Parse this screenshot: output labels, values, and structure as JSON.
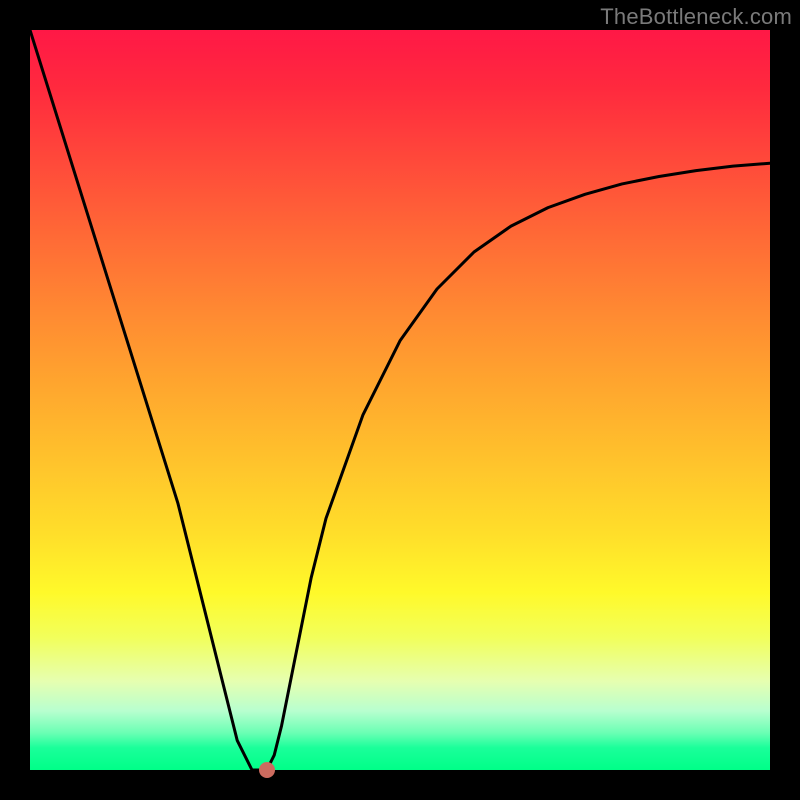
{
  "watermark": "TheBottleneck.com",
  "colors": {
    "frame": "#000000",
    "gradient_top": "#ff1846",
    "gradient_bottom": "#00ff88",
    "curve": "#000000",
    "dot": "#cc6b5f",
    "watermark": "#7a7a7a"
  },
  "chart_data": {
    "type": "line",
    "title": "",
    "xlabel": "",
    "ylabel": "",
    "xlim": [
      0,
      100
    ],
    "ylim": [
      0,
      100
    ],
    "grid": false,
    "legend": false,
    "series": [
      {
        "name": "bottleneck-curve",
        "x": [
          0,
          5,
          10,
          15,
          20,
          24,
          26,
          28,
          30,
          31,
          32,
          33,
          34,
          36,
          38,
          40,
          45,
          50,
          55,
          60,
          65,
          70,
          75,
          80,
          85,
          90,
          95,
          100
        ],
        "y": [
          100,
          84,
          68,
          52,
          36,
          20,
          12,
          4,
          0,
          0,
          0,
          2,
          6,
          16,
          26,
          34,
          48,
          58,
          65,
          70,
          73.5,
          76,
          77.8,
          79.2,
          80.2,
          81,
          81.6,
          82
        ]
      }
    ],
    "annotations": [
      {
        "name": "optimal-point",
        "x": 32,
        "y": 0,
        "label": ""
      }
    ]
  }
}
